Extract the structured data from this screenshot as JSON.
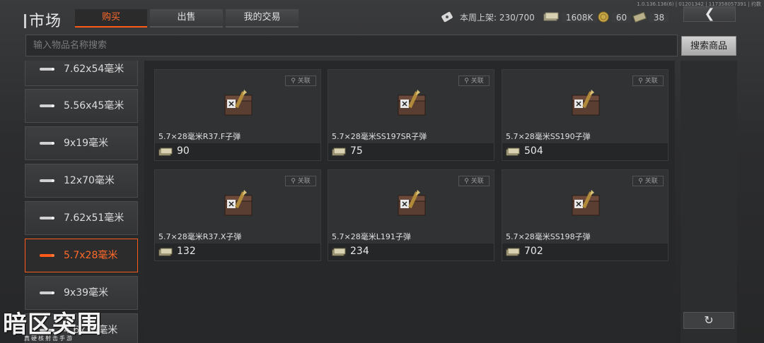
{
  "version": "1.0.136.136(6) | 01201342 | 117358057391 | 约数",
  "header": {
    "title": "市场",
    "tabs": [
      {
        "label": "购买",
        "active": true
      },
      {
        "label": "出售",
        "active": false
      },
      {
        "label": "我的交易",
        "active": false
      }
    ],
    "weekly_label": "本周上架:",
    "weekly_value": "230/700",
    "currency_cash": "1608K",
    "currency_coin": "60",
    "currency_bills": "38"
  },
  "search": {
    "placeholder": "输入物品名称搜索",
    "button_label": "搜索商品"
  },
  "sidebar": {
    "items": [
      {
        "label": "7.62x54毫米",
        "active": false
      },
      {
        "label": "5.56x45毫米",
        "active": false
      },
      {
        "label": "9x19毫米",
        "active": false
      },
      {
        "label": "12x70毫米",
        "active": false
      },
      {
        "label": "7.62x51毫米",
        "active": false
      },
      {
        "label": "5.7x28毫米",
        "active": true
      },
      {
        "label": "9x39毫米",
        "active": false
      },
      {
        "label": "4.6x30毫米",
        "active": false
      }
    ]
  },
  "cards": [
    {
      "name": "5.7×28毫米R37.F子弹",
      "price": "90",
      "link_label": "关联"
    },
    {
      "name": "5.7×28毫米SS197SR子弹",
      "price": "75",
      "link_label": "关联"
    },
    {
      "name": "5.7×28毫米SS190子弹",
      "price": "504",
      "link_label": "关联"
    },
    {
      "name": "5.7×28毫米R37.X子弹",
      "price": "132",
      "link_label": "关联"
    },
    {
      "name": "5.7×28毫米L191子弹",
      "price": "234",
      "link_label": "关联"
    },
    {
      "name": "5.7×28毫米SS198子弹",
      "price": "702",
      "link_label": "关联"
    }
  ],
  "logo": {
    "title": "暗区突围",
    "subtitle": "真硬核射击手游"
  },
  "colors": {
    "accent": "#ff5a1a"
  }
}
